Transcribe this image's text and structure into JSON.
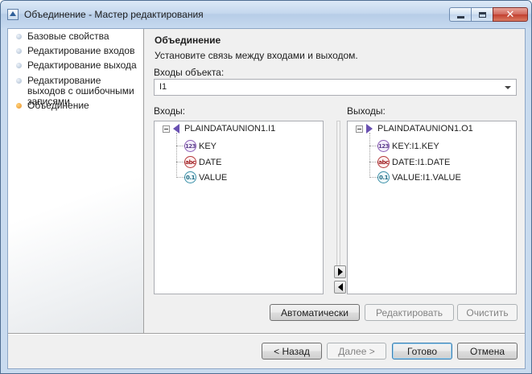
{
  "window": {
    "title": "Объединение - Мастер редактирования",
    "minimize_glyph": "",
    "maximize_glyph": "",
    "close_glyph": "✕"
  },
  "steps": [
    {
      "label": "Базовые свойства",
      "active": false
    },
    {
      "label": "Редактирование входов",
      "active": false
    },
    {
      "label": "Редактирование выхода",
      "active": false
    },
    {
      "label": "Редактирование выходов с ошибочными записями",
      "active": false
    },
    {
      "label": "Объединение",
      "active": true
    }
  ],
  "header": {
    "title": "Объединение",
    "subtitle": "Установите связь между входами и выходом."
  },
  "object_inputs": {
    "label": "Входы объекта:",
    "selected": "I1"
  },
  "inputs_tree": {
    "label": "Входы:",
    "root": "PLAINDATAUNION1.I1",
    "items": [
      {
        "type": "int",
        "icon": "123",
        "name": "KEY"
      },
      {
        "type": "str",
        "icon": "abc",
        "name": "DATE"
      },
      {
        "type": "dbl",
        "icon": "0.1",
        "name": "VALUE"
      }
    ]
  },
  "outputs_tree": {
    "label": "Выходы:",
    "root": "PLAINDATAUNION1.O1",
    "items": [
      {
        "type": "int",
        "icon": "123",
        "name": "KEY:I1.KEY"
      },
      {
        "type": "str",
        "icon": "abc",
        "name": "DATE:I1.DATE"
      },
      {
        "type": "dbl",
        "icon": "0.1",
        "name": "VALUE:I1.VALUE"
      }
    ]
  },
  "mapping_buttons": {
    "auto": "Автоматически",
    "edit": "Редактировать",
    "clear": "Очистить"
  },
  "footer": {
    "back": "< Назад",
    "next": "Далее >",
    "finish": "Готово",
    "cancel": "Отмена"
  },
  "colors": {
    "accent_active_step": "#e8912a",
    "port_icon": "#6a51b2",
    "close_button": "#c2402f"
  }
}
